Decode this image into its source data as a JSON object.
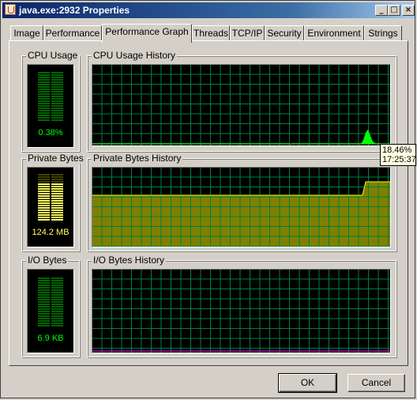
{
  "window": {
    "title": "java.exe:2932 Properties",
    "icon": "java-icon"
  },
  "caption_buttons": {
    "minimize": "_",
    "maximize": "□",
    "close": "×"
  },
  "tabs": [
    {
      "label": "Image"
    },
    {
      "label": "Performance"
    },
    {
      "label": "Performance Graph",
      "active": true
    },
    {
      "label": "Threads"
    },
    {
      "label": "TCP/IP"
    },
    {
      "label": "Security"
    },
    {
      "label": "Environment"
    },
    {
      "label": "Strings"
    }
  ],
  "cpu": {
    "meter_label": "CPU Usage",
    "value": "0.38%",
    "level": 0.0038,
    "history_label": "CPU Usage History",
    "spike": [
      0,
      0.05,
      0.14,
      0.18,
      0.1,
      0.03,
      0.01
    ]
  },
  "private_bytes": {
    "meter_label": "Private Bytes",
    "value": "124.2 MB",
    "level": 0.78,
    "history_label": "Private Bytes History",
    "level_before": 0.65,
    "level_after": 0.82
  },
  "io": {
    "meter_label": "I/O Bytes",
    "value": "6.9 KB",
    "level": 0.0,
    "history_label": "I/O Bytes History"
  },
  "tooltip": {
    "line1": "18.46%",
    "line2": "17:25:37"
  },
  "buttons": {
    "ok": "OK",
    "cancel": "Cancel"
  },
  "colors": {
    "cpu_green": "#00ff00",
    "meter_dim": "#006600",
    "grid": "#008040",
    "private_fill": "#808000",
    "private_line": "#ffff00",
    "meter_yellow": "#ffff60",
    "io_line": "#ff00ff",
    "kernel_red": "#ff0000"
  }
}
